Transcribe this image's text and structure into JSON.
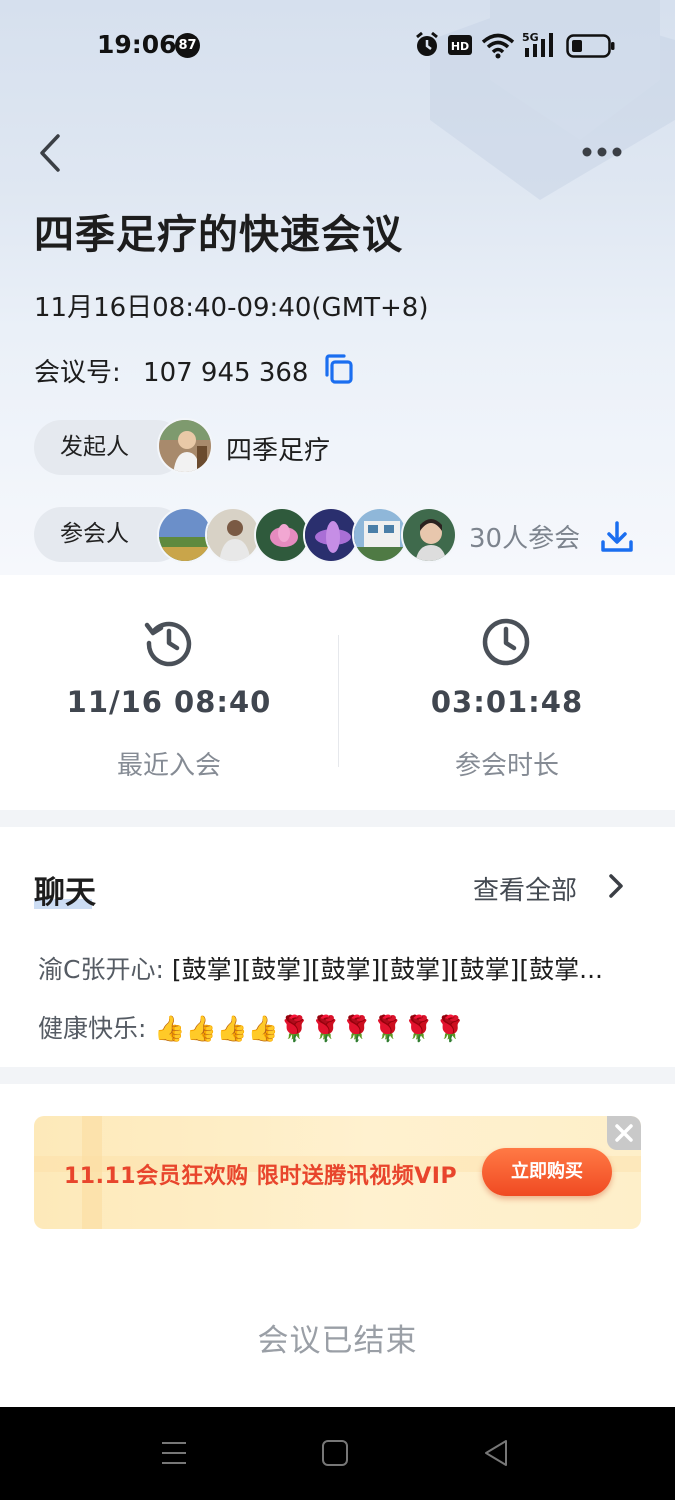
{
  "status_bar": {
    "time": "19:06",
    "notification_count": "87",
    "network": "5G"
  },
  "header": {
    "back_icon": "chevron-left-icon",
    "more_icon": "more-horizontal-icon"
  },
  "meeting": {
    "title": "四季足疗的快速会议",
    "time_range": "11月16日08:40-09:40(GMT+8)",
    "id_label": "会议号:",
    "id_value": "107 945 368",
    "host_label": "发起人",
    "host_name": "四季足疗",
    "participants_label": "参会人",
    "participants_count": "30人参会"
  },
  "stats": {
    "last_join_value": "11/16 08:40",
    "last_join_label": "最近入会",
    "duration_value": "03:01:48",
    "duration_label": "参会时长"
  },
  "chat": {
    "title": "聊天",
    "view_all": "查看全部",
    "messages": [
      {
        "sender": "渝C张开心:",
        "text": "[鼓掌][鼓掌][鼓掌][鼓掌][鼓掌][鼓掌..."
      },
      {
        "sender": "健康快乐:",
        "text": "👍👍👍👍🌹🌹🌹🌹🌹🌹"
      }
    ]
  },
  "banner": {
    "promo_text": "11.11会员狂欢购 限时送腾讯视频VIP",
    "button_label": "立即购买"
  },
  "footer": {
    "ended_text": "会议已结束"
  },
  "colors": {
    "accent_blue": "#1a6ef0",
    "promo_red": "#e8452c",
    "button_orange": "#f04a22"
  }
}
